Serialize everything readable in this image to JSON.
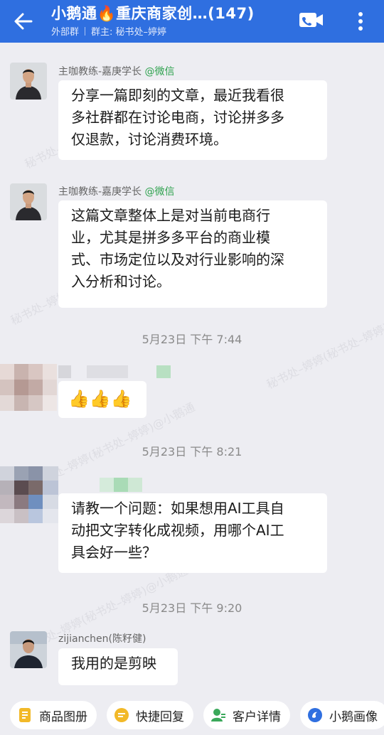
{
  "header": {
    "title": "小鹅通🔥重庆商家创…(147)",
    "group_type": "外部群",
    "owner": "群主: 秘书处–婷婷"
  },
  "messages": [
    {
      "sender": "主咖教练-嘉庚学长",
      "sender_tag": "@微信",
      "lines": [
        "分享一篇即刻的文章，最近我看很",
        "多社群都在讨论电商，讨论拼多多",
        "仅退款，讨论消费环境。"
      ]
    },
    {
      "sender": "主咖教练-嘉庚学长",
      "sender_tag": "@微信",
      "lines": [
        "这篇文章整体上是对当前电商行",
        "业，尤其是拼多多平台的商业模",
        "式、市场定位以及对行业影响的深",
        "入分析和讨论。"
      ]
    },
    {
      "time": "5月23日  下午 7:44"
    },
    {
      "lines": [
        "👍👍👍"
      ]
    },
    {
      "time": "5月23日  下午 8:21"
    },
    {
      "lines": [
        "请教一个问题：如果想用AI工具自",
        "动把文字转化成视频，用哪个AI工",
        "具会好一些？"
      ]
    },
    {
      "time": "5月23日  下午 9:20"
    },
    {
      "sender": "zijianchen(陈籽健)",
      "lines": [
        "我用的是剪映"
      ]
    }
  ],
  "watermark": "秘书处–婷婷(秘书处–婷婷)@小鹅通",
  "bottom_bar": [
    {
      "label": "商品图册",
      "icon": "product-album-icon",
      "color": "#f2b928"
    },
    {
      "label": "快捷回复",
      "icon": "quick-reply-icon",
      "color": "#f2b928"
    },
    {
      "label": "客户详情",
      "icon": "customer-detail-icon",
      "color": "#3aa85a"
    },
    {
      "label": "小鹅画像",
      "icon": "goose-profile-icon",
      "color": "#2f6fe0"
    }
  ],
  "colors": {
    "header": "#2f6fe0",
    "background": "#ededf2",
    "tag": "#2fa24f"
  }
}
